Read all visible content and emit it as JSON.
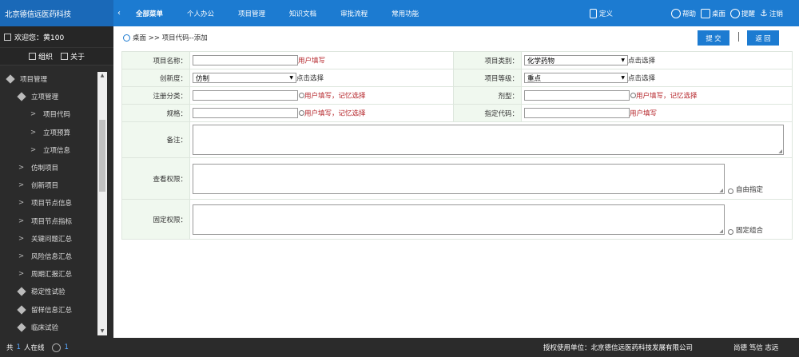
{
  "app": {
    "brand": "北京德信远医药科技",
    "collapse_glyph": "‹"
  },
  "menu": {
    "items": [
      "全部菜单",
      "个人办公",
      "项目管理",
      "知识文档",
      "审批流程",
      "常用功能"
    ]
  },
  "toolbar": {
    "define": "定义",
    "help": "帮助",
    "desktop": "桌面",
    "remind": "提醒",
    "logout": "注销"
  },
  "sidebar": {
    "welcome": "欢迎您：黄100",
    "org": "组织",
    "about": "关于",
    "items": [
      {
        "label": "项目管理",
        "level": 0
      },
      {
        "label": "立项管理",
        "level": 1
      },
      {
        "label": "项目代码",
        "level": 2
      },
      {
        "label": "立项预算",
        "level": 2
      },
      {
        "label": "立项信息",
        "level": 2
      },
      {
        "label": "仿制项目",
        "level": 1
      },
      {
        "label": "创新项目",
        "level": 1
      },
      {
        "label": "项目节点信息",
        "level": 1
      },
      {
        "label": "项目节点指标",
        "level": 1
      },
      {
        "label": "关键问题汇总",
        "level": 1
      },
      {
        "label": "风险信息汇总",
        "level": 1
      },
      {
        "label": "周期汇报汇总",
        "level": 1
      },
      {
        "label": "稳定性试验",
        "level": 0
      },
      {
        "label": "留样信息汇总",
        "level": 0
      },
      {
        "label": "临床试验",
        "level": 0
      }
    ]
  },
  "breadcrumb": "桌面 >> 项目代码--添加",
  "buttons": {
    "submit": "提 交",
    "back": "返 回"
  },
  "form": {
    "project_name": {
      "label": "项目名称：",
      "hint": "用户填写"
    },
    "project_type": {
      "label": "项目类别：",
      "value": "化学药物",
      "hint": "点击选择"
    },
    "innovation": {
      "label": "创新度：",
      "value": "仿制",
      "hint": "点击选择"
    },
    "project_grade": {
      "label": "项目等级：",
      "value": "重点",
      "hint": "点击选择"
    },
    "reg_class": {
      "label": "注册分类：",
      "hint": "用户填写，记忆选择"
    },
    "dosage_form": {
      "label": "剂型：",
      "hint": "用户填写，记忆选择"
    },
    "spec": {
      "label": "规格：",
      "hint": "用户填写，记忆选择"
    },
    "assigned_code": {
      "label": "指定代码：",
      "hint": "用户填写"
    },
    "remarks": {
      "label": "备注："
    },
    "view_perm": {
      "label": "查看权限：",
      "hint": "自由指定"
    },
    "fixed_perm": {
      "label": "固定权限：",
      "hint": "固定组合"
    }
  },
  "footer": {
    "total_prefix": "共",
    "online_count": "1",
    "online_suffix": "人在线",
    "msg_count": "1",
    "licensee": "授权使用单位：北京德信远医药科技发展有限公司",
    "vendor": "尚德 笃信 志远"
  }
}
